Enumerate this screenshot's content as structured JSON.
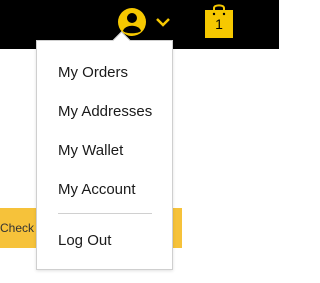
{
  "header": {
    "cart_count": "1",
    "colors": {
      "background": "#000000",
      "accent": "#f6c800"
    },
    "icons": {
      "user": "user-circle-icon",
      "dropdown": "chevron-down-icon",
      "cart": "shopping-bag-icon"
    }
  },
  "account_menu": {
    "items": [
      {
        "label": "My Orders"
      },
      {
        "label": "My Addresses"
      },
      {
        "label": "My Wallet"
      },
      {
        "label": "My Account"
      }
    ],
    "logout_label": "Log Out"
  },
  "banner": {
    "text": "Check o",
    "color": "#f6c23a"
  }
}
